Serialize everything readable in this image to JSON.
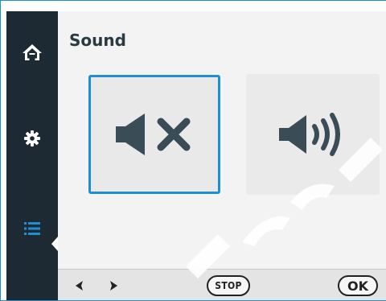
{
  "page": {
    "title": "Sound"
  },
  "sidebar": {
    "items": [
      {
        "name": "home",
        "icon": "home-icon"
      },
      {
        "name": "settings",
        "icon": "gear-icon"
      },
      {
        "name": "menu",
        "icon": "list-icon"
      }
    ],
    "active": "menu"
  },
  "options": [
    {
      "name": "mute",
      "icon": "speaker-muted-icon",
      "selected": true
    },
    {
      "name": "sound-on",
      "icon": "speaker-on-icon",
      "selected": false
    }
  ],
  "bottom_bar": {
    "prev_icon": "arrow-left-icon",
    "next_icon": "arrow-right-icon",
    "stop_label": "STOP",
    "ok_label": "OK"
  },
  "colors": {
    "sidebar": "#1d2a33",
    "accent": "#1e8fd3",
    "icon_dark": "#3a4d56",
    "icon_active": "#1e8fd3"
  }
}
